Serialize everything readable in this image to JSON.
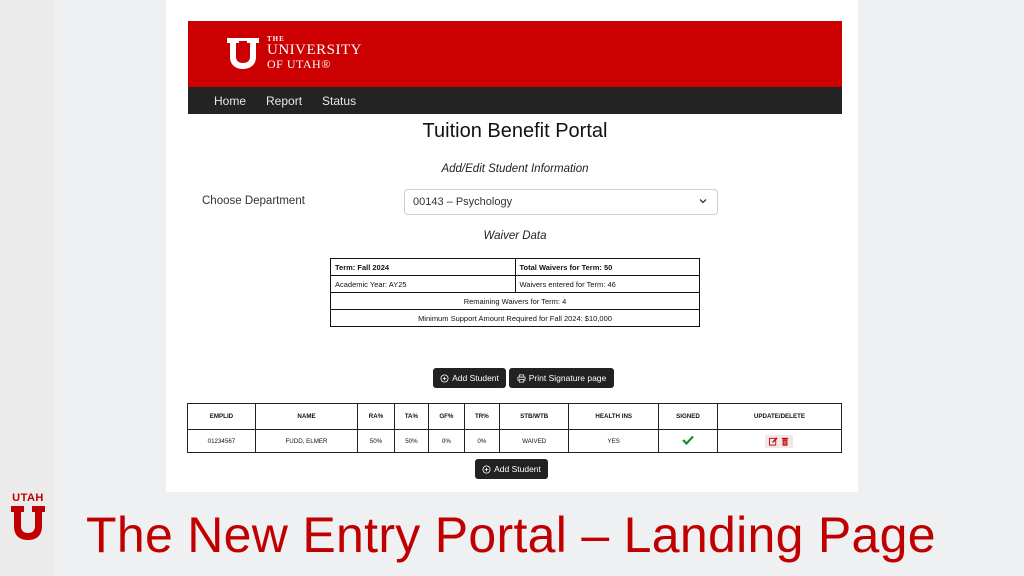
{
  "brand": {
    "the": "THE",
    "university": "UNIVERSITY",
    "of_utah": "OF UTAH®",
    "corner_text": "UTAH",
    "red": "#cc0000"
  },
  "nav": {
    "items": [
      {
        "label": "Home"
      },
      {
        "label": "Report"
      },
      {
        "label": "Status"
      }
    ]
  },
  "page": {
    "title": "Tuition Benefit Portal",
    "subtitle": "Add/Edit Student Information"
  },
  "department": {
    "label": "Choose Department",
    "selected": "00143 – Psychology"
  },
  "waiver": {
    "title": "Waiver Data",
    "term": "Term: Fall 2024",
    "total": "Total Waivers for Term: 50",
    "academic_year": "Academic Year: AY25",
    "entered": "Waivers entered for Term: 46",
    "remaining": "Remaining Waivers for Term: 4",
    "minimum": "Minimum Support Amount Required for Fall 2024: $10,000"
  },
  "buttons": {
    "add_student": "Add Student",
    "print_signature": "Print Signature page",
    "add_student_bottom": "Add Student"
  },
  "student_table": {
    "headers": [
      "EMPLID",
      "NAME",
      "RA%",
      "TA%",
      "GF%",
      "TR%",
      "STB/WTB",
      "HEALTH INS",
      "SIGNED",
      "UPDATE/DELETE"
    ],
    "rows": [
      {
        "emplid": "01234567",
        "name": "FUDD, ELMER",
        "ra": "50%",
        "ta": "50%",
        "gf": "0%",
        "tr": "0%",
        "stb": "WAIVED",
        "health": "YES"
      }
    ]
  },
  "slide": {
    "title": "The New Entry Portal – Landing Page"
  },
  "icons": {
    "signed": "check-icon",
    "edit": "edit-icon",
    "delete": "trash-icon",
    "add": "plus-circle-icon",
    "print": "printer-icon"
  }
}
